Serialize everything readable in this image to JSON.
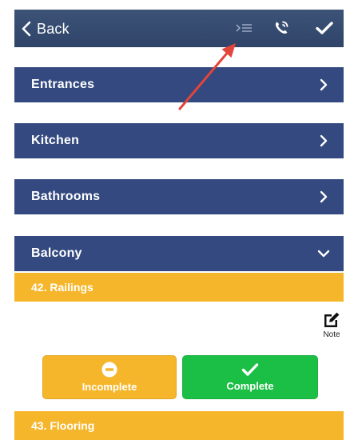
{
  "header": {
    "back_label": "Back",
    "icons": [
      "outline-list-icon",
      "phone-call-icon",
      "checkmark-icon"
    ]
  },
  "sections": [
    {
      "label": "Entrances",
      "state": "collapsed"
    },
    {
      "label": "Kitchen",
      "state": "collapsed"
    },
    {
      "label": "Bathrooms",
      "state": "collapsed"
    },
    {
      "label": "Balcony",
      "state": "expanded"
    }
  ],
  "items": [
    {
      "label": "42. Railings",
      "note_label": "Note",
      "incomplete_label": "Incomplete",
      "complete_label": "Complete"
    },
    {
      "label": "43. Flooring"
    }
  ],
  "colors": {
    "header": "#2f4468",
    "section": "#33497f",
    "item": "#f6b62b",
    "complete": "#1cbf45",
    "annotation_arrow": "#e2453a"
  }
}
